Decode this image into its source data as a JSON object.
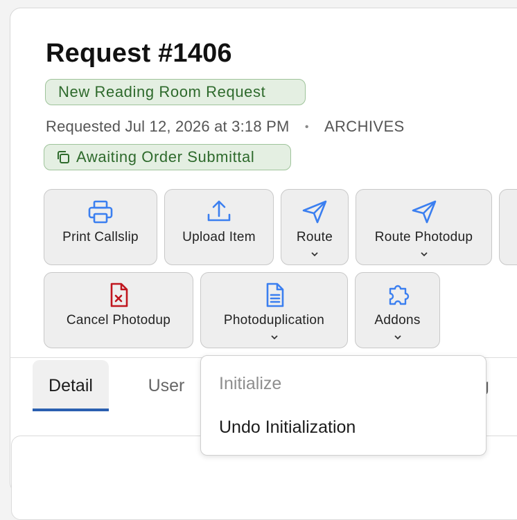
{
  "request": {
    "title": "Request #1406",
    "type_label": "New Reading Room Request",
    "requested_text": "Requested Jul 12, 2026 at 3:18 PM",
    "separator": "•",
    "department": "ARCHIVES",
    "status_label": "Awaiting Order Submittal"
  },
  "actions": {
    "print_callslip": "Print Callslip",
    "upload_item": "Upload Item",
    "route": "Route",
    "route_photodup": "Route Photodup",
    "cancel_photodup": "Cancel Photodup",
    "photoduplication": "Photoduplication",
    "addons": "Addons"
  },
  "tabs": {
    "detail": "Detail",
    "user": "User",
    "partial": "ng"
  },
  "dropdown": {
    "initialize": "Initialize",
    "undo_initialization": "Undo Initialization"
  },
  "colors": {
    "accent_blue": "#3b7ff0",
    "danger_red": "#c0161e",
    "status_green": "#2e6a2c",
    "tab_underline": "#2a5fb0"
  }
}
